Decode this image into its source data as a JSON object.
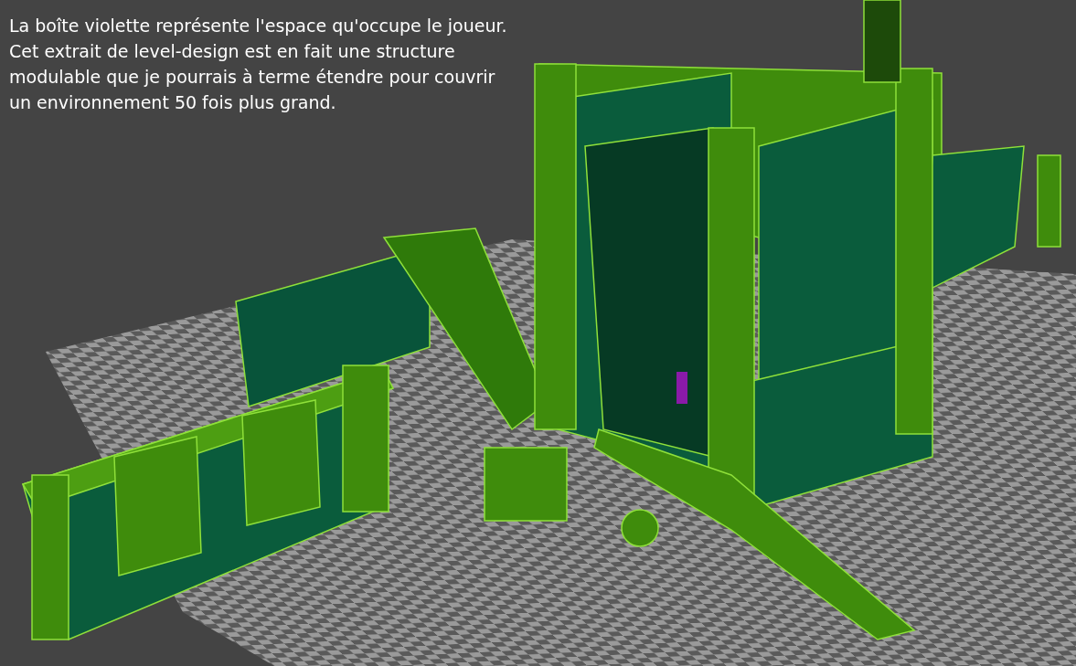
{
  "caption": "La boîte violette représente l'espace qu'occupe le joueur. Cet extrait de level-design est en fait une structure modulable que je pourrais à terme étendre pour couvrir un environnement 50 fois plus grand."
}
